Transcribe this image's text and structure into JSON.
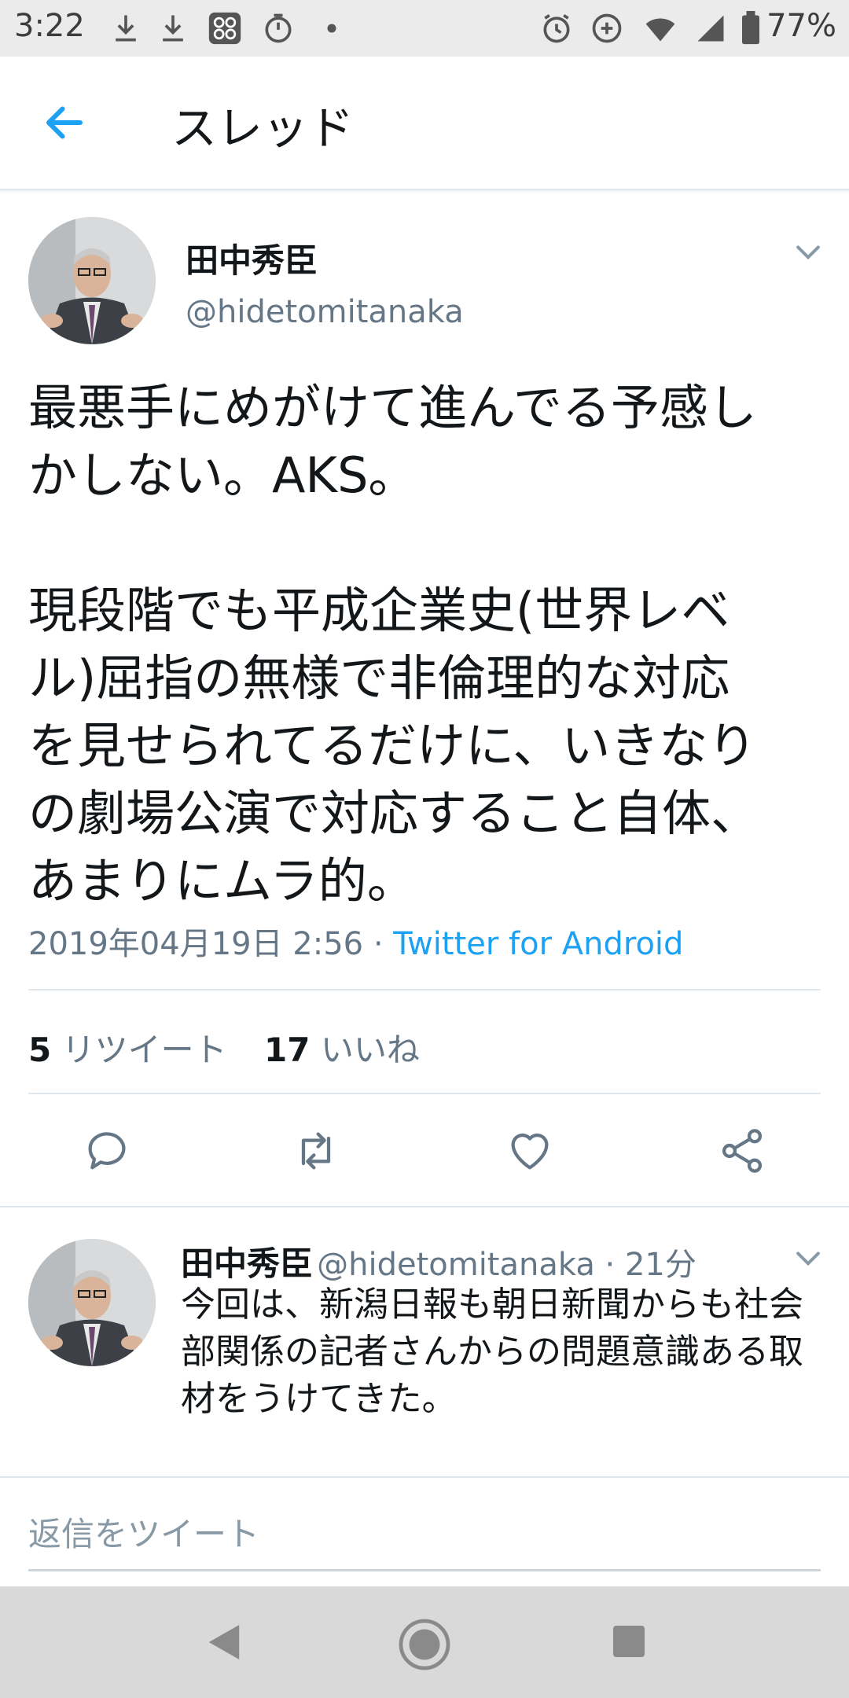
{
  "status_bar": {
    "time": "3:22",
    "battery": "77%"
  },
  "header": {
    "title": "スレッド"
  },
  "tweet": {
    "name": "田中秀臣",
    "handle": "@hidetomitanaka",
    "text": "最悪手にめがけて進んでる予感し\nかしない。AKS。\n\n現段階でも平成企業史(世界レベ\nル)屈指の無様で非倫理的な対応\nを見せられてるだけに、いきなり\nの劇場公演で対応すること自体、\nあまりにムラ的。",
    "date": "2019年04月19日 2:56 · ",
    "source": "Twitter for Android",
    "retweet_count": "5",
    "retweet_label": "リツイート",
    "like_count": "17",
    "like_label": "いいね"
  },
  "reply": {
    "name": "田中秀臣",
    "handle_time": "@hidetomitanaka · 21分",
    "text": "今回は、新潟日報も朝日新聞からも社会\n部関係の記者さんからの問題意識ある取\n材をうけてきた。"
  },
  "compose": {
    "placeholder": "返信をツイート"
  },
  "colors": {
    "accent": "#1da1f2",
    "secondary_text": "#657786",
    "separator": "#e1e8ed"
  }
}
